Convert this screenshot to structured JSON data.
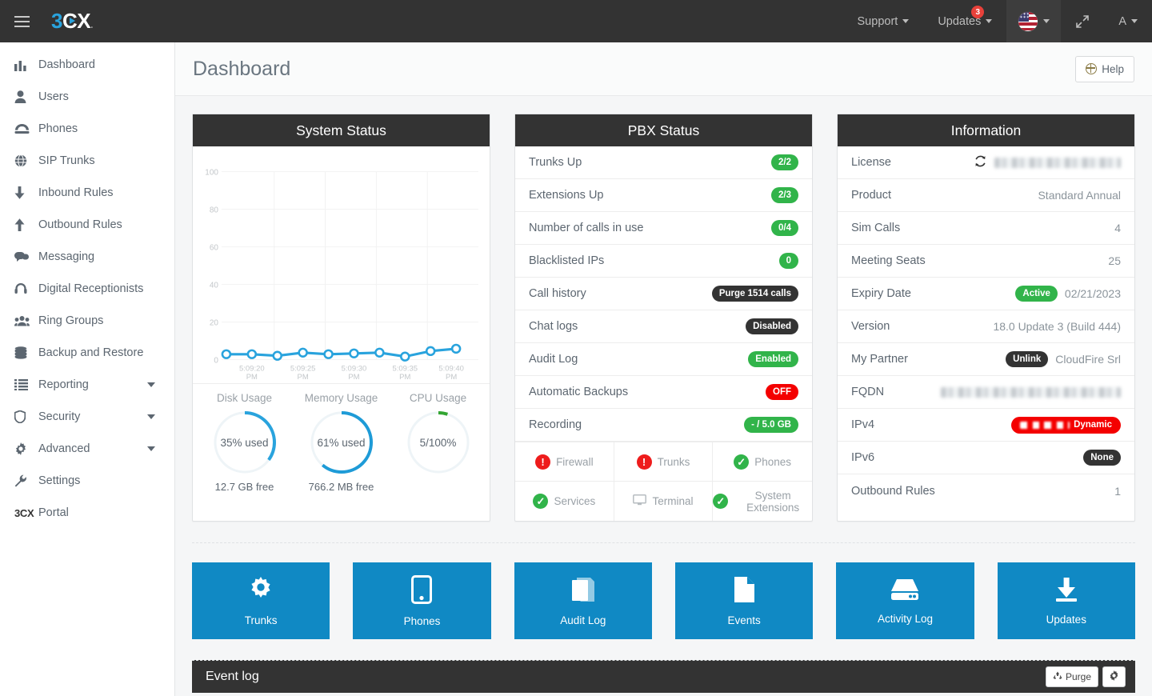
{
  "topbar": {
    "logo_3": "3",
    "logo_c": "C",
    "logo_x": "X",
    "menu_icon": "hamburger-icon",
    "support_label": "Support",
    "updates_label": "Updates",
    "updates_badge": "3",
    "language": "en-US",
    "expand_icon": "⤡",
    "account_label": "A"
  },
  "sidebar": {
    "items": [
      {
        "label": "Dashboard",
        "icon": "chart-bar-icon",
        "expandable": false
      },
      {
        "label": "Users",
        "icon": "user-icon",
        "expandable": false
      },
      {
        "label": "Phones",
        "icon": "desk-phone-icon",
        "expandable": false
      },
      {
        "label": "SIP Trunks",
        "icon": "globe-icon",
        "expandable": false
      },
      {
        "label": "Inbound Rules",
        "icon": "arrow-down-icon",
        "expandable": false
      },
      {
        "label": "Outbound Rules",
        "icon": "arrow-up-icon",
        "expandable": false
      },
      {
        "label": "Messaging",
        "icon": "chat-bubble-icon",
        "expandable": false
      },
      {
        "label": "Digital Receptionists",
        "icon": "headset-icon",
        "expandable": false
      },
      {
        "label": "Ring Groups",
        "icon": "users-group-icon",
        "expandable": false
      },
      {
        "label": "Backup and Restore",
        "icon": "database-icon",
        "expandable": false
      },
      {
        "label": "Reporting",
        "icon": "list-icon",
        "expandable": true
      },
      {
        "label": "Security",
        "icon": "shield-icon",
        "expandable": true
      },
      {
        "label": "Advanced",
        "icon": "gear-icon",
        "expandable": true
      },
      {
        "label": "Settings",
        "icon": "wrench-icon",
        "expandable": false
      }
    ],
    "portal_label": "Portal",
    "portal_logo": "3CX"
  },
  "page": {
    "title": "Dashboard",
    "help_label": "Help"
  },
  "system_status": {
    "title": "System Status",
    "gauges": [
      {
        "title": "Disk Usage",
        "value": "35% used",
        "free": "12.7 GB free",
        "percent": 35,
        "color": "#29a3dd"
      },
      {
        "title": "Memory Usage",
        "value": "61% used",
        "free": "766.2 MB free",
        "percent": 61,
        "color": "#1e9bd7"
      },
      {
        "title": "CPU Usage",
        "value": "5/100%",
        "free": "",
        "percent": 5,
        "color": "#33a532"
      }
    ]
  },
  "chart_data": {
    "type": "line",
    "title": "System Status",
    "x": [
      "5:09:17 PM",
      "5:09:20 PM",
      "5:09:22 PM",
      "5:09:25 PM",
      "5:09:27 PM",
      "5:09:30 PM",
      "5:09:35 PM",
      "5:09:37 PM",
      "5:09:40 PM",
      "5:09:43 PM"
    ],
    "tick_labels": [
      "5:09:20 PM",
      "5:09:25 PM",
      "5:09:30 PM",
      "5:09:35 PM",
      "5:09:40 PM"
    ],
    "series": [
      {
        "name": "CPU Usage",
        "values": [
          3,
          3,
          2,
          4,
          3,
          3,
          4,
          2,
          5,
          6
        ],
        "color": "#29a3dd"
      }
    ],
    "ylim": [
      0,
      100
    ],
    "yticks": [
      0,
      20,
      40,
      60,
      80,
      100
    ],
    "xlabel": "",
    "ylabel": "",
    "grid": true,
    "legend": "none"
  },
  "pbx_status": {
    "title": "PBX Status",
    "rows": [
      {
        "label": "Trunks Up",
        "value": "2/2",
        "style": "green"
      },
      {
        "label": "Extensions Up",
        "value": "2/3",
        "style": "green"
      },
      {
        "label": "Number of calls in use",
        "value": "0/4",
        "style": "green"
      },
      {
        "label": "Blacklisted IPs",
        "value": "0",
        "style": "green"
      },
      {
        "label": "Call history",
        "value": "Purge 1514 calls",
        "style": "dark"
      },
      {
        "label": "Chat logs",
        "value": "Disabled",
        "style": "dark"
      },
      {
        "label": "Audit Log",
        "value": "Enabled",
        "style": "green"
      },
      {
        "label": "Automatic Backups",
        "value": "OFF",
        "style": "red"
      },
      {
        "label": "Recording",
        "value": "- / 5.0 GB",
        "style": "green"
      }
    ],
    "services": [
      {
        "label": "Firewall",
        "state": "error",
        "icon": "alert-icon"
      },
      {
        "label": "Trunks",
        "state": "error",
        "icon": "alert-icon"
      },
      {
        "label": "Phones",
        "state": "ok",
        "icon": "check-icon"
      },
      {
        "label": "Services",
        "state": "ok",
        "icon": "check-icon"
      },
      {
        "label": "Terminal",
        "state": "neutral",
        "icon": "monitor-icon"
      },
      {
        "label": "System Extensions",
        "state": "ok",
        "icon": "check-icon"
      }
    ]
  },
  "information": {
    "title": "Information",
    "rows": [
      {
        "label": "License",
        "value": "",
        "type": "redacted-refresh"
      },
      {
        "label": "Product",
        "value": "Standard Annual",
        "type": "text"
      },
      {
        "label": "Sim Calls",
        "value": "4",
        "type": "text"
      },
      {
        "label": "Meeting Seats",
        "value": "25",
        "type": "text"
      },
      {
        "label": "Expiry Date",
        "value": "02/21/2023",
        "badge": "Active",
        "type": "badge-green"
      },
      {
        "label": "Version",
        "value": "18.0 Update 3 (Build 444)",
        "type": "text"
      },
      {
        "label": "My Partner",
        "value": "CloudFire Srl",
        "badge": "Unlink",
        "type": "badge-dark"
      },
      {
        "label": "FQDN",
        "value": "",
        "type": "redacted"
      },
      {
        "label": "IPv4",
        "value": "Dynamic",
        "type": "redacted-red-badge"
      },
      {
        "label": "IPv6",
        "value": "None",
        "type": "badge-dark-only"
      },
      {
        "label": "Outbound Rules",
        "value": "1",
        "type": "text"
      }
    ]
  },
  "tiles": [
    {
      "label": "Trunks",
      "icon": "gear-icon"
    },
    {
      "label": "Phones",
      "icon": "mobile-phone-icon"
    },
    {
      "label": "Audit Log",
      "icon": "book-icon"
    },
    {
      "label": "Events",
      "icon": "document-icon"
    },
    {
      "label": "Activity Log",
      "icon": "hard-drive-icon"
    },
    {
      "label": "Updates",
      "icon": "download-icon"
    }
  ],
  "event_log": {
    "title": "Event log",
    "purge_label": "Purge",
    "settings_icon": "gear-icon"
  },
  "colors": {
    "accent_blue": "#1089c4",
    "logo_blue": "#29a3dd",
    "green": "#31b44a",
    "red": "#f40000",
    "dark": "#333333"
  }
}
